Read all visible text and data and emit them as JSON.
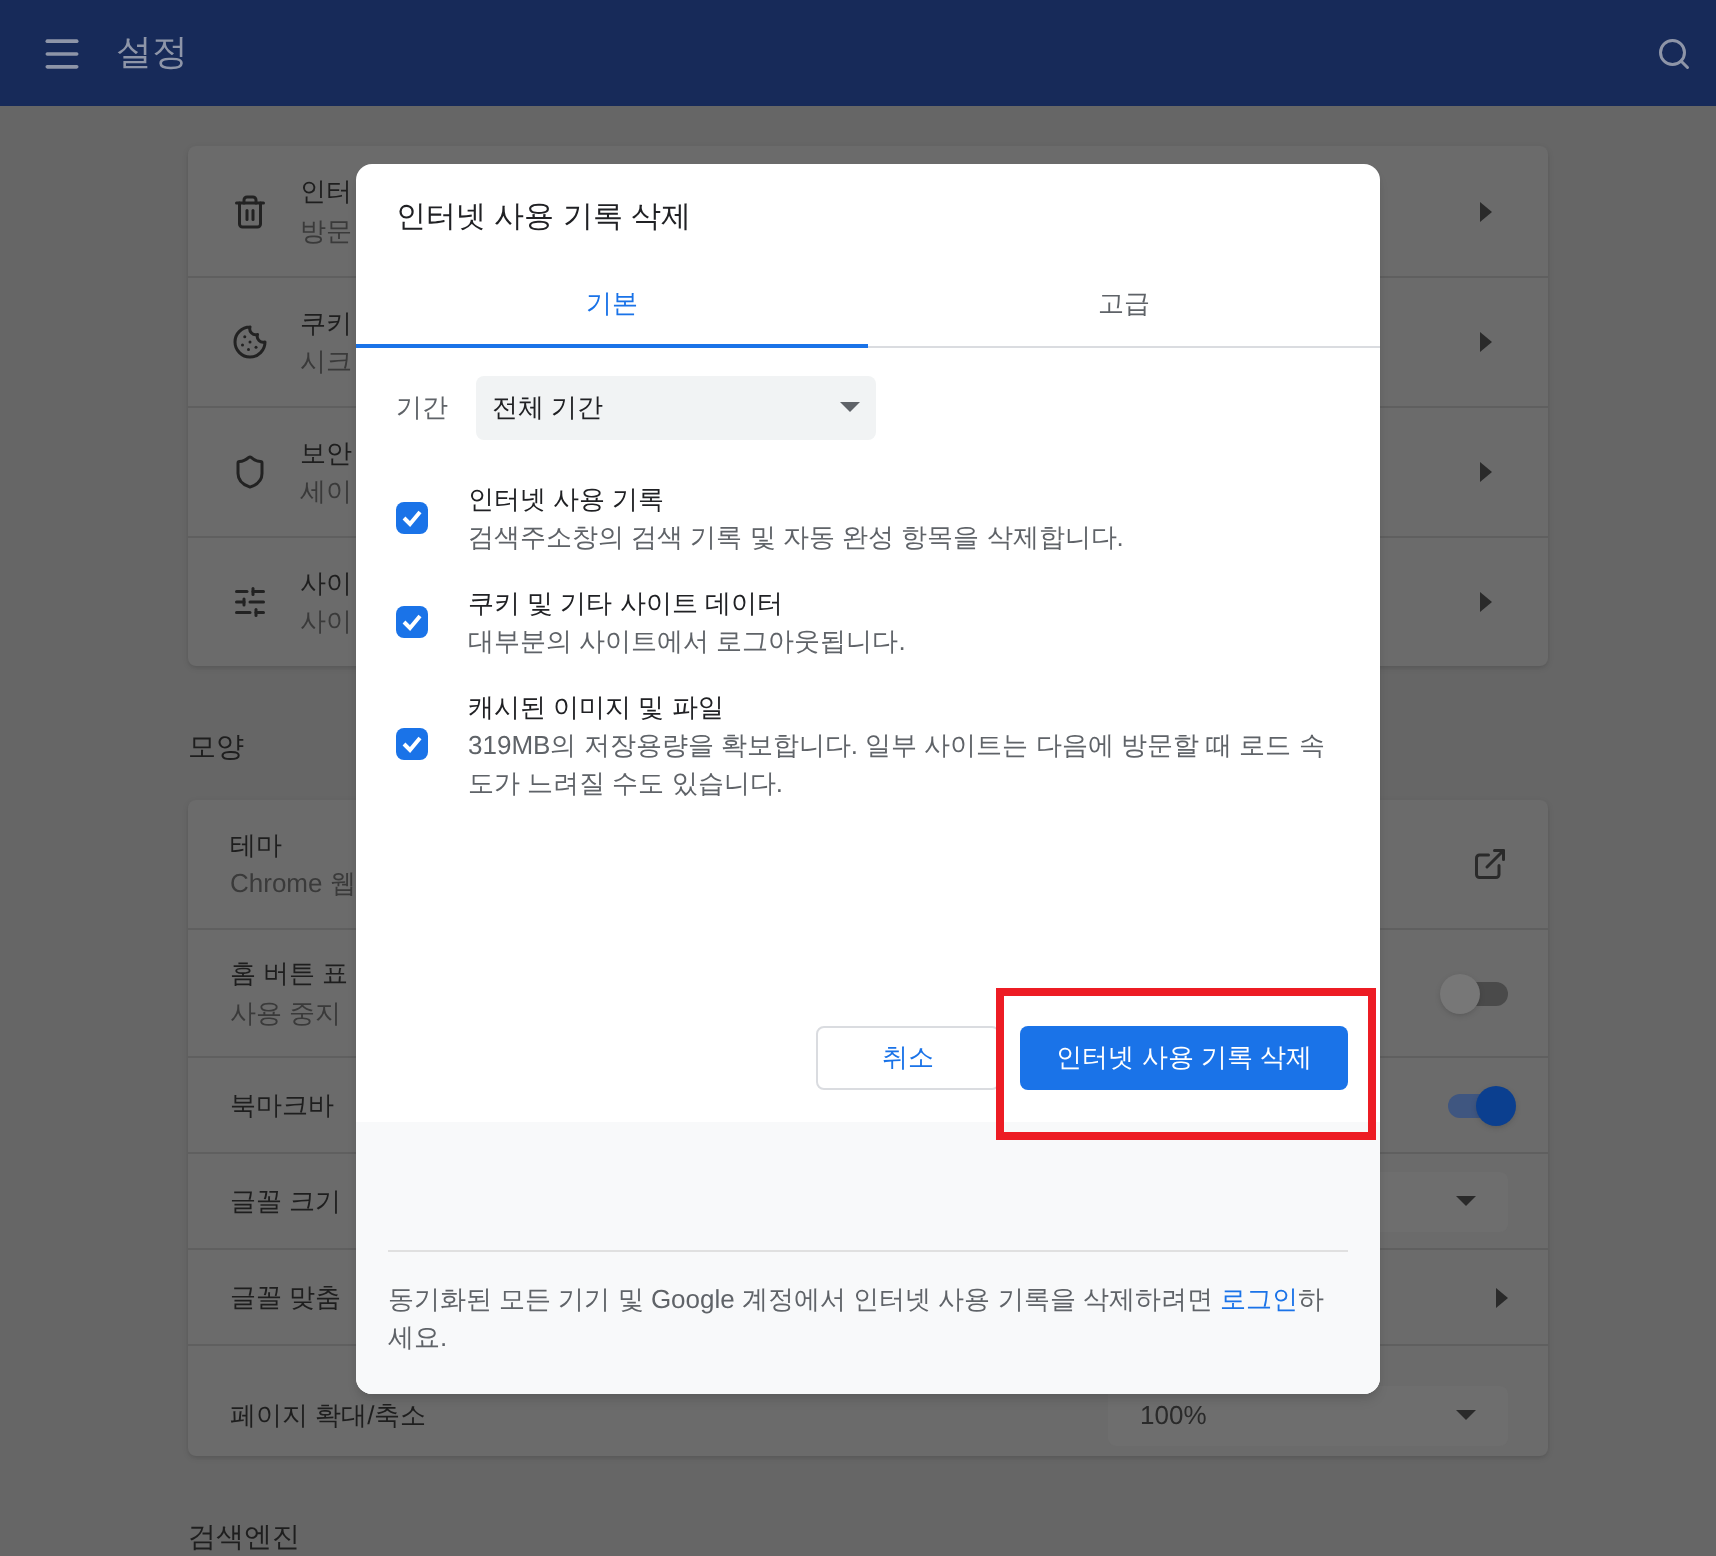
{
  "header": {
    "title": "설정"
  },
  "privacy_rows": [
    {
      "title": "인터",
      "subtitle": "방문"
    },
    {
      "title": "쿠키",
      "subtitle": "시크"
    },
    {
      "title": "보안",
      "subtitle": "세이"
    },
    {
      "title": "사이",
      "subtitle": "사이"
    }
  ],
  "appearance_heading": "모양",
  "appearance_rows": [
    {
      "kind": "link",
      "title": "테마",
      "subtitle": "Chrome 웹"
    },
    {
      "kind": "toggle",
      "title": "홈 버튼 표",
      "subtitle": "사용 중지",
      "on": false
    },
    {
      "kind": "toggle",
      "title": "북마크바",
      "on": true
    },
    {
      "kind": "select",
      "title": "글꼴 크기"
    },
    {
      "kind": "arrow",
      "title": "글꼴 맞춤"
    },
    {
      "kind": "select",
      "title": "페이지 확대/축소",
      "value": "100%"
    }
  ],
  "search_heading": "검색엔진",
  "dialog": {
    "title": "인터넷 사용 기록 삭제",
    "tabs": [
      {
        "label": "기본",
        "selected": true
      },
      {
        "label": "고급",
        "selected": false
      }
    ],
    "period_label": "기간",
    "period_value": "전체 기간",
    "options": [
      {
        "title": "인터넷 사용 기록",
        "description": "검색주소창의 검색 기록 및 자동 완성 항목을 삭제합니다.",
        "checked": true
      },
      {
        "title": "쿠키 및 기타 사이트 데이터",
        "description": "대부분의 사이트에서 로그아웃됩니다.",
        "checked": true
      },
      {
        "title": "캐시된 이미지 및 파일",
        "description": "319MB의 저장용량을 확보합니다. 일부 사이트는 다음에 방문할 때 로드 속도가 느려질 수도 있습니다.",
        "checked": true
      }
    ],
    "cancel_button": "취소",
    "confirm_button": "인터넷 사용 기록 삭제",
    "confirm_highlighted": true,
    "footer": {
      "text_before": "동기화된 모든 기기 및 Google 계정에서 인터넷 사용 기록을 삭제하려면 ",
      "link": "로그인",
      "text_after": "하세요."
    }
  }
}
